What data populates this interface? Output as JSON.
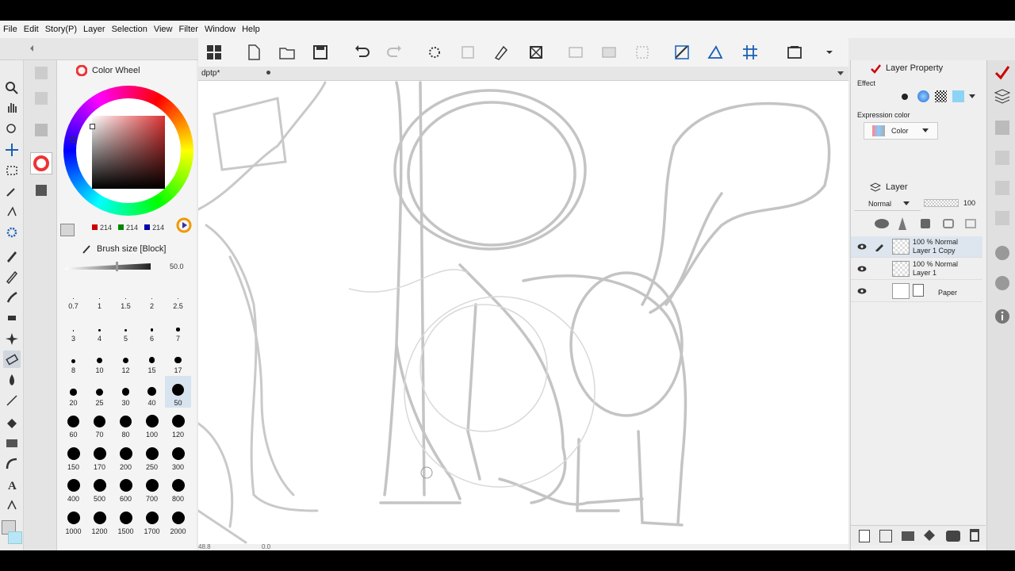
{
  "menu": [
    "File",
    "Edit",
    "Story(P)",
    "Layer",
    "Selection",
    "View",
    "Filter",
    "Window",
    "Help"
  ],
  "document": {
    "tab_name": "dptp*"
  },
  "color_panel": {
    "title": "Color Wheel",
    "r": "214",
    "g": "214",
    "b": "214",
    "current_color": "#d6d6d6"
  },
  "brush_panel": {
    "title": "Brush size [Block]",
    "value": "50.0",
    "sizes": [
      "0.7",
      "1",
      "1.5",
      "2",
      "2.5",
      "3",
      "4",
      "5",
      "6",
      "7",
      "8",
      "10",
      "12",
      "15",
      "17",
      "20",
      "25",
      "30",
      "40",
      "50",
      "60",
      "70",
      "80",
      "100",
      "120",
      "150",
      "170",
      "200",
      "250",
      "300",
      "400",
      "500",
      "600",
      "700",
      "800",
      "1000",
      "1200",
      "1500",
      "1700",
      "2000"
    ],
    "selected": "50"
  },
  "layer_property": {
    "title": "Layer Property",
    "effect_label": "Effect",
    "expression_label": "Expression color",
    "expression_value": "Color"
  },
  "layer_panel": {
    "title": "Layer",
    "blend_mode": "Normal",
    "opacity": "100",
    "layers": [
      {
        "opacity": "100 %",
        "mode": "Normal",
        "name": "Layer 1 Copy",
        "selected": true
      },
      {
        "opacity": "100 %",
        "mode": "Normal",
        "name": "Layer 1",
        "selected": false
      },
      {
        "opacity": "",
        "mode": "",
        "name": "Paper",
        "selected": false
      }
    ]
  },
  "status": {
    "zoom": "48.8",
    "angle": "0.0"
  }
}
